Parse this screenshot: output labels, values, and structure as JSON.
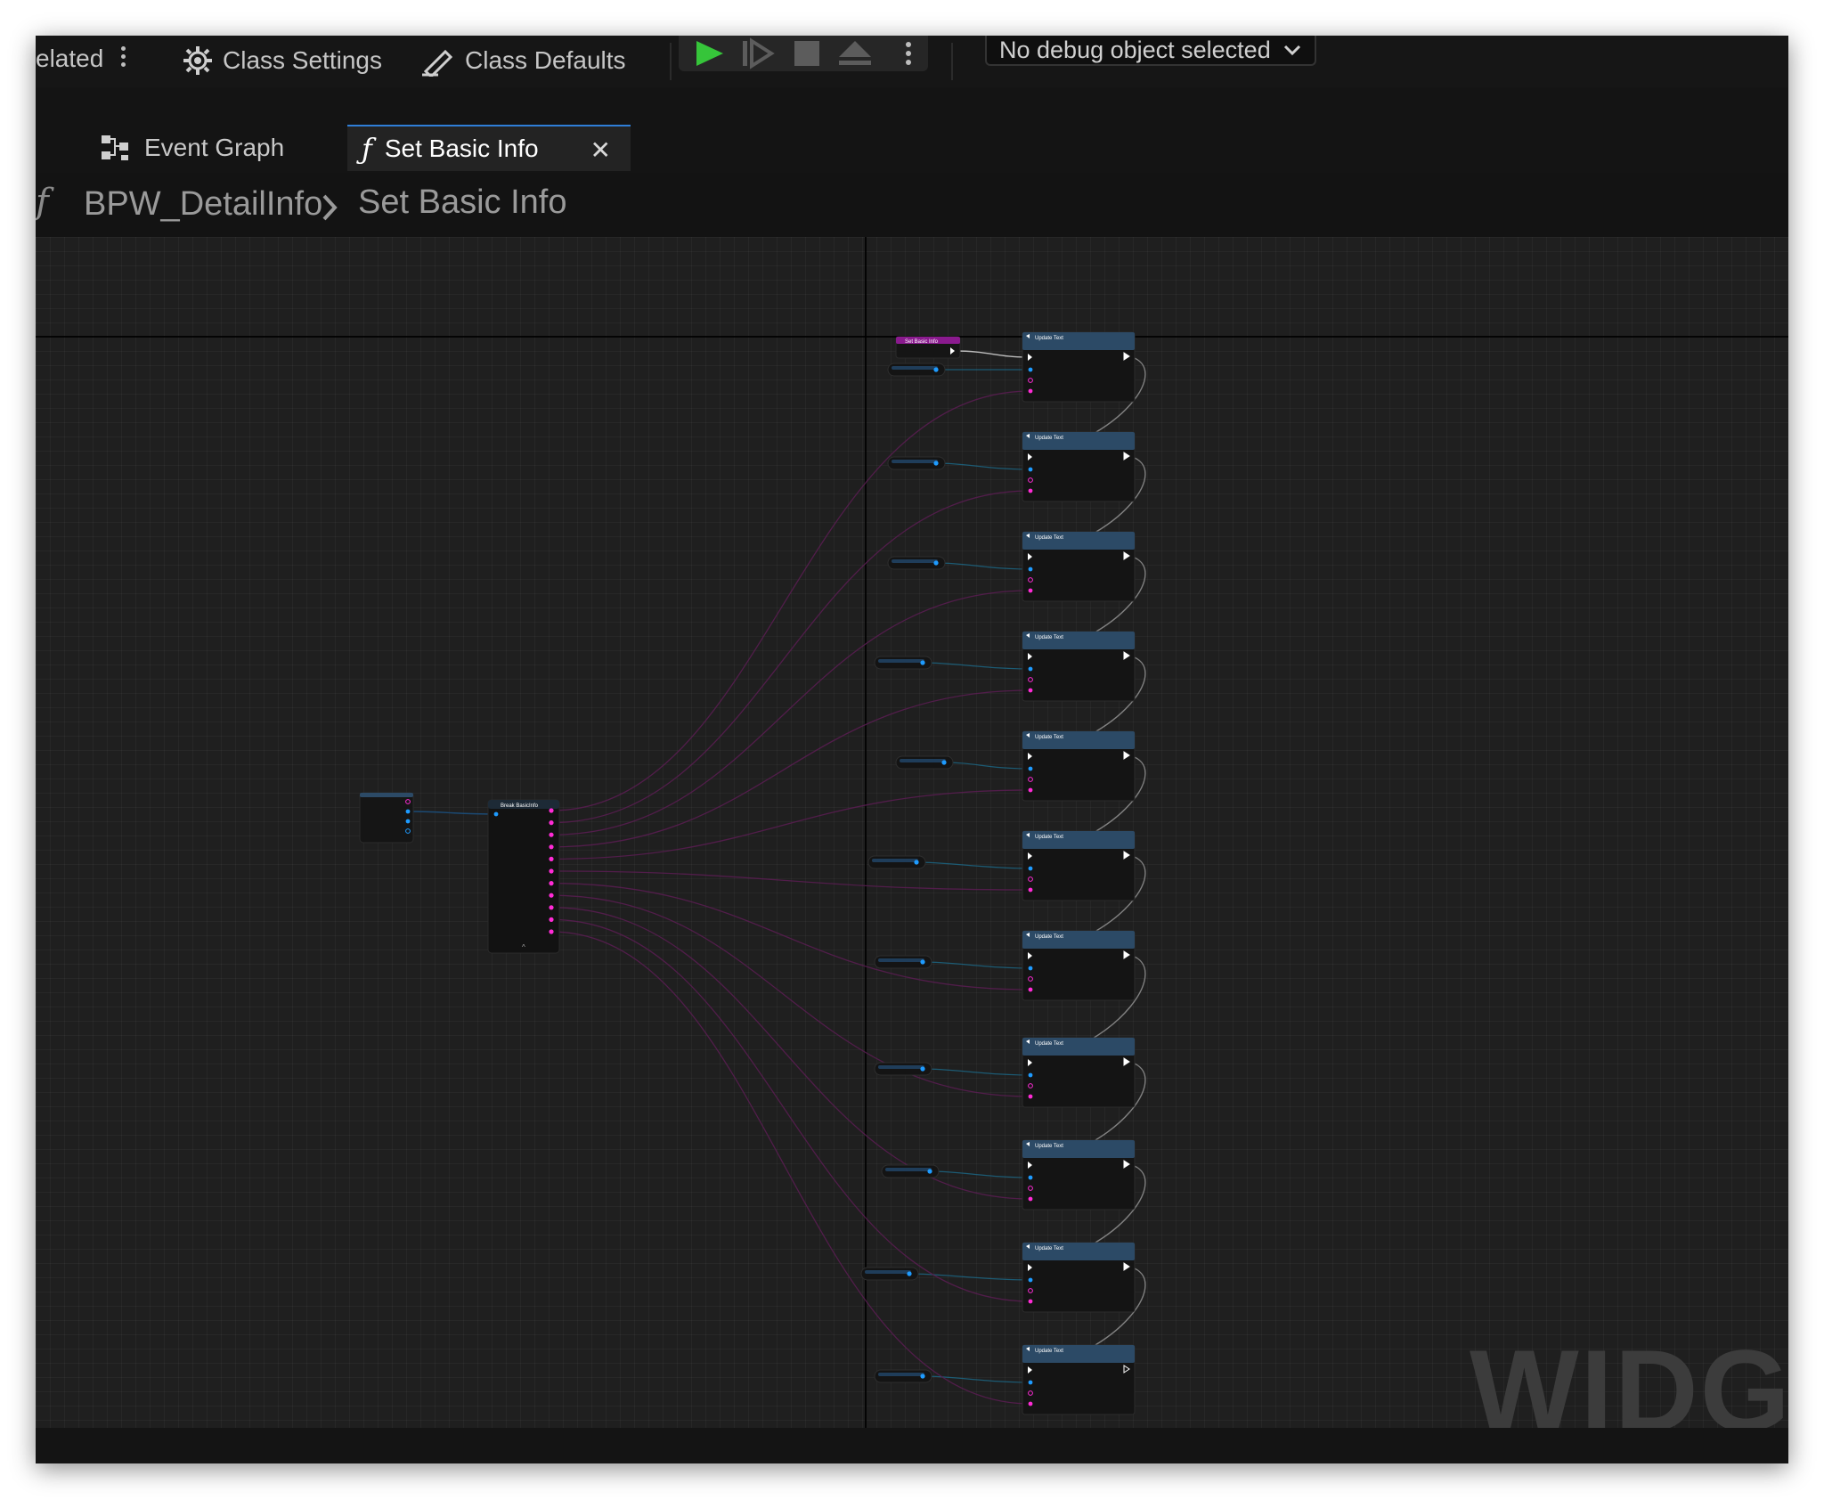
{
  "toolbar": {
    "related_label": "elated",
    "class_settings_label": "Class Settings",
    "class_defaults_label": "Class Defaults",
    "debug_object_label": "No debug object selected"
  },
  "tabs": [
    {
      "label": "Event Graph",
      "icon": "graph-icon",
      "active": false
    },
    {
      "label": "Set Basic Info",
      "icon": "function-icon",
      "active": true
    }
  ],
  "breadcrumb": {
    "root": "BPW_DetailInfo",
    "current": "Set Basic Info"
  },
  "graph": {
    "entry_node_title": "Set Basic Info",
    "break_node_title": "Break BasicInfo",
    "update_node_title": "Update Text",
    "update_node_count": 11,
    "variable_node_count": 11,
    "watermark": "WIDGET"
  },
  "colors": {
    "accent": "#2f7ed8",
    "exec_pin": "#ffffff",
    "data_pin_blue": "#1e9bff",
    "data_pin_magenta": "#ff2bd6",
    "function_header": "#8a1a8e",
    "node_header": "#2c4a66",
    "play_green": "#36c53a"
  }
}
